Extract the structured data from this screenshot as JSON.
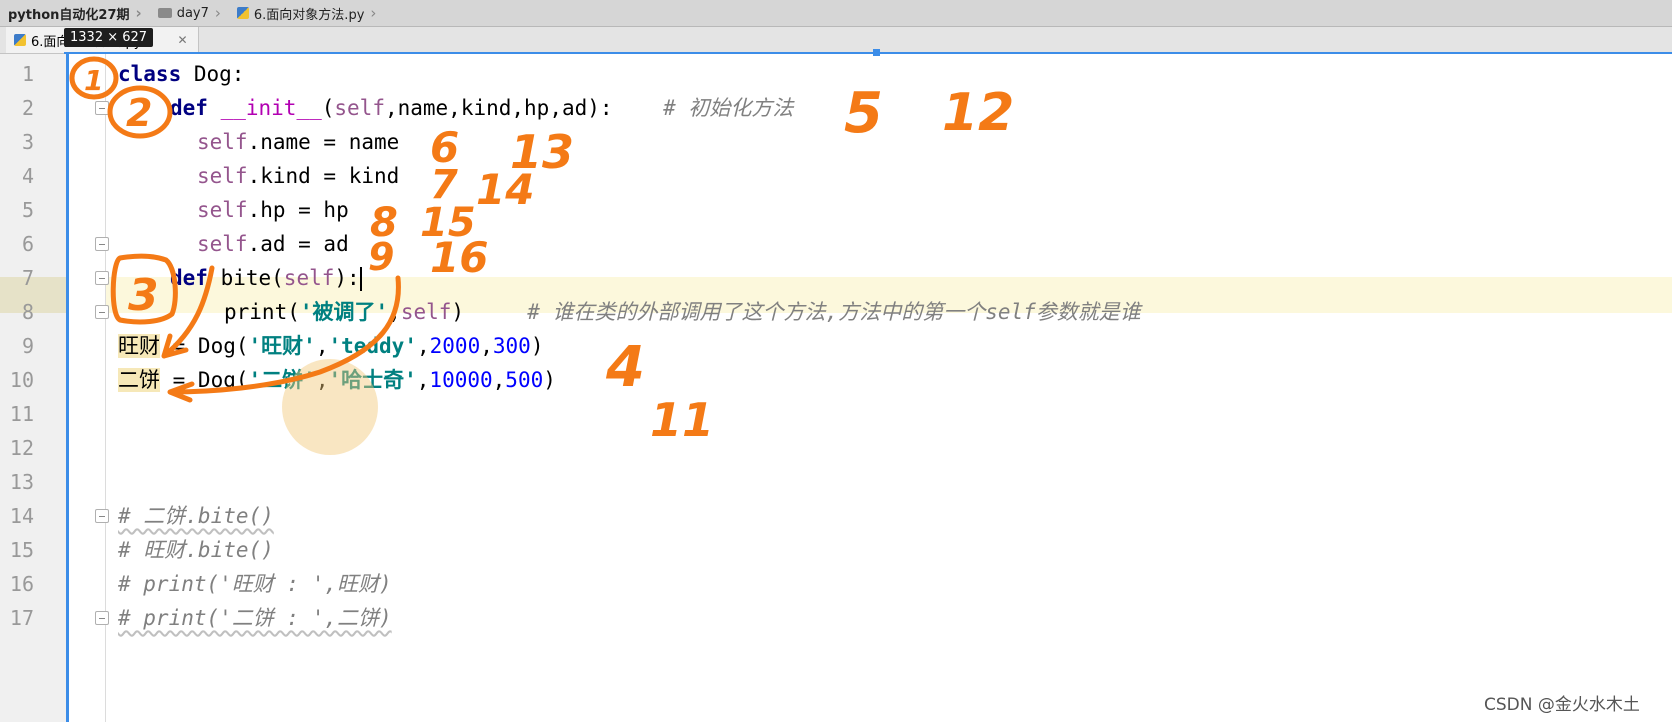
{
  "breadcrumb": {
    "project": "python自动化27期",
    "folder": "day7",
    "file": "6.面向对象方法.py"
  },
  "tab": {
    "label": "6.面向对象方法.py",
    "close_glyph": "✕"
  },
  "tooltip": {
    "text": "1332 × 627"
  },
  "code_lines": [
    {
      "num": "1"
    },
    {
      "num": "2"
    },
    {
      "num": "3"
    },
    {
      "num": "4"
    },
    {
      "num": "5"
    },
    {
      "num": "6"
    },
    {
      "num": "7"
    },
    {
      "num": "8"
    },
    {
      "num": "9"
    },
    {
      "num": "10"
    },
    {
      "num": "11"
    },
    {
      "num": "12"
    },
    {
      "num": "13"
    },
    {
      "num": "14"
    },
    {
      "num": "15"
    },
    {
      "num": "16"
    },
    {
      "num": "17"
    }
  ],
  "code": {
    "l1": {
      "kw": "class",
      "name": " Dog:"
    },
    "l2": {
      "kw": "def",
      "fn": " __init__",
      "open": "(",
      "self": "self",
      "params": ",name,kind,hp,ad):",
      "comment": "# 初始化方法"
    },
    "l3": {
      "self": "self",
      "rest": ".name = name"
    },
    "l4": {
      "self": "self",
      "rest": ".kind = kind"
    },
    "l5": {
      "self": "self",
      "rest": ".hp = hp"
    },
    "l6": {
      "self": "self",
      "rest": ".ad = ad"
    },
    "l7": {
      "kw": "def",
      "fn": " bite(",
      "self": "self",
      "close": "):"
    },
    "l8": {
      "fn": "print(",
      "str": "'被调了'",
      "comma": ",",
      "self": "self",
      "close": ")",
      "comment": "# 谁在类的外部调用了这个方法,方法中的第一个self参数就是谁"
    },
    "l9": {
      "var": "旺财",
      "assign": " = Dog(",
      "s1": "'旺财'",
      "c1": ",",
      "s2": "'teddy'",
      "c2": ",",
      "n1": "2000",
      "c3": ",",
      "n2": "300",
      "close": ")"
    },
    "l10": {
      "var": "二饼",
      "assign": " = Dog(",
      "s1": "'二饼'",
      "c1": ",",
      "s2": "'哈士奇'",
      "c2": ",",
      "n1": "10000",
      "c3": ",",
      "n2": "500",
      "close": ")"
    },
    "l14": "# 二饼.bite()",
    "l15": "# 旺财.bite()",
    "l16": "# print('旺财 : ',旺财)",
    "l17": "# print('二饼 : ',二饼)"
  },
  "annotations": [
    "1",
    "2",
    "3",
    "4",
    "5",
    "6",
    "7",
    "8",
    "9",
    "11",
    "12",
    "13",
    "14",
    "15",
    "16"
  ],
  "annotation_color": "#f47a16",
  "watermark": {
    "text": "CSDN @金火水木土"
  }
}
